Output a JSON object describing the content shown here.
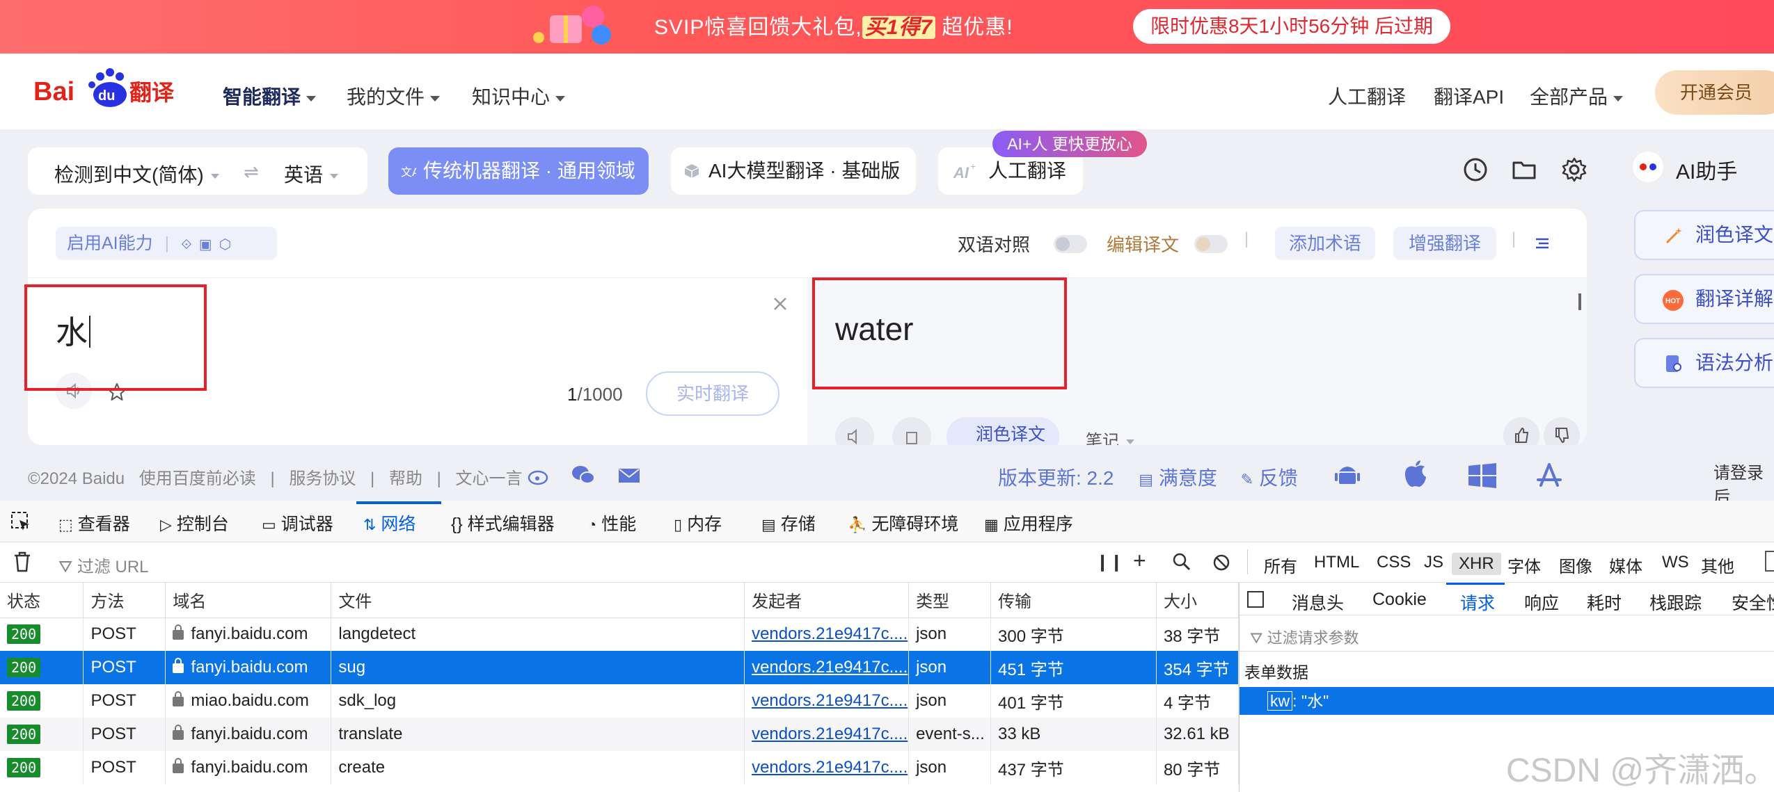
{
  "promo": {
    "text_before": "SVIP惊喜回馈大礼包,",
    "highlight": "买1得7",
    "text_after": "超优惠!",
    "countdown": "限时优惠8天1小时56分钟 后过期"
  },
  "nav": {
    "logo": "Bai du 翻译",
    "items": [
      "智能翻译",
      "我的文件",
      "知识中心"
    ],
    "right_items": [
      "人工翻译",
      "翻译API",
      "全部产品"
    ],
    "vip": "开通会员"
  },
  "lang": {
    "source": "检测到中文(简体)",
    "swap": "⇌",
    "target": "英语"
  },
  "modes": {
    "machine": "传统机器翻译 · 通用领域",
    "ai": "AI大模型翻译 · 基础版",
    "human": "人工翻译",
    "human_badge": "AI+人 更快更放心"
  },
  "card": {
    "ai_ability": "启用AI能力",
    "bilingual": "双语对照",
    "edit": "编辑译文",
    "add_term": "添加术语",
    "enhance": "增强翻译",
    "source_text": "水",
    "target_text": "water",
    "counter_current": "1",
    "counter_max": "/1000",
    "realtime": "实时翻译",
    "polish": "润色译文",
    "notes": "笔记"
  },
  "side": {
    "title": "AI助手",
    "buttons": [
      "润色译文",
      "翻译详解",
      "语法分析"
    ],
    "login": "请登录后"
  },
  "footer": {
    "copyright": "©2024 Baidu",
    "links": [
      "使用百度前必读",
      "|",
      "服务协议",
      "|",
      "帮助",
      "|",
      "文心一言"
    ],
    "version": "版本更新: 2.2",
    "satisfaction": "满意度",
    "feedback": "反馈"
  },
  "devtools": {
    "tabs": [
      "查看器",
      "控制台",
      "调试器",
      "网络",
      "样式编辑器",
      "性能",
      "内存",
      "存储",
      "无障碍环境",
      "应用程序"
    ],
    "active_tab": "网络",
    "filter_placeholder": "过滤 URL",
    "types": [
      "所有",
      "HTML",
      "CSS",
      "JS",
      "XHR",
      "字体",
      "图像",
      "媒体",
      "WS",
      "其他"
    ],
    "active_type": "XHR",
    "columns": [
      "状态",
      "方法",
      "域名",
      "文件",
      "发起者",
      "类型",
      "传输",
      "大小"
    ],
    "rows": [
      {
        "status": "200",
        "method": "POST",
        "domain": "fanyi.baidu.com",
        "file": "langdetect",
        "initiator": "vendors.21e9417c....",
        "type": "json",
        "transfer": "300 字节",
        "size": "38 字节"
      },
      {
        "status": "200",
        "method": "POST",
        "domain": "fanyi.baidu.com",
        "file": "sug",
        "initiator": "vendors.21e9417c....",
        "type": "json",
        "transfer": "451 字节",
        "size": "354 字节"
      },
      {
        "status": "200",
        "method": "POST",
        "domain": "miao.baidu.com",
        "file": "sdk_log",
        "initiator": "vendors.21e9417c....",
        "type": "json",
        "transfer": "401 字节",
        "size": "4 字节"
      },
      {
        "status": "200",
        "method": "POST",
        "domain": "fanyi.baidu.com",
        "file": "translate",
        "initiator": "vendors.21e9417c....",
        "type": "event-s...",
        "transfer": "33 kB",
        "size": "32.61 kB"
      },
      {
        "status": "200",
        "method": "POST",
        "domain": "fanyi.baidu.com",
        "file": "create",
        "initiator": "vendors.21e9417c....",
        "type": "json",
        "transfer": "437 字节",
        "size": "80 字节"
      }
    ],
    "selected_row": 1,
    "detail_tabs": [
      "消息头",
      "Cookie",
      "请求",
      "响应",
      "耗时",
      "栈跟踪",
      "安全性"
    ],
    "active_detail_tab": "请求",
    "detail_filter": "过滤请求参数",
    "form_title": "表单数据",
    "form_key": "kw",
    "form_value": ": \"水\""
  },
  "watermark": "CSDN @齐潇洒。",
  "colors": {
    "accent": "#7b8ef6",
    "promo": "#ff5757",
    "devtools_blue": "#0060df",
    "selected_row": "#0a73e6",
    "highlight_box": "#e8202a"
  }
}
